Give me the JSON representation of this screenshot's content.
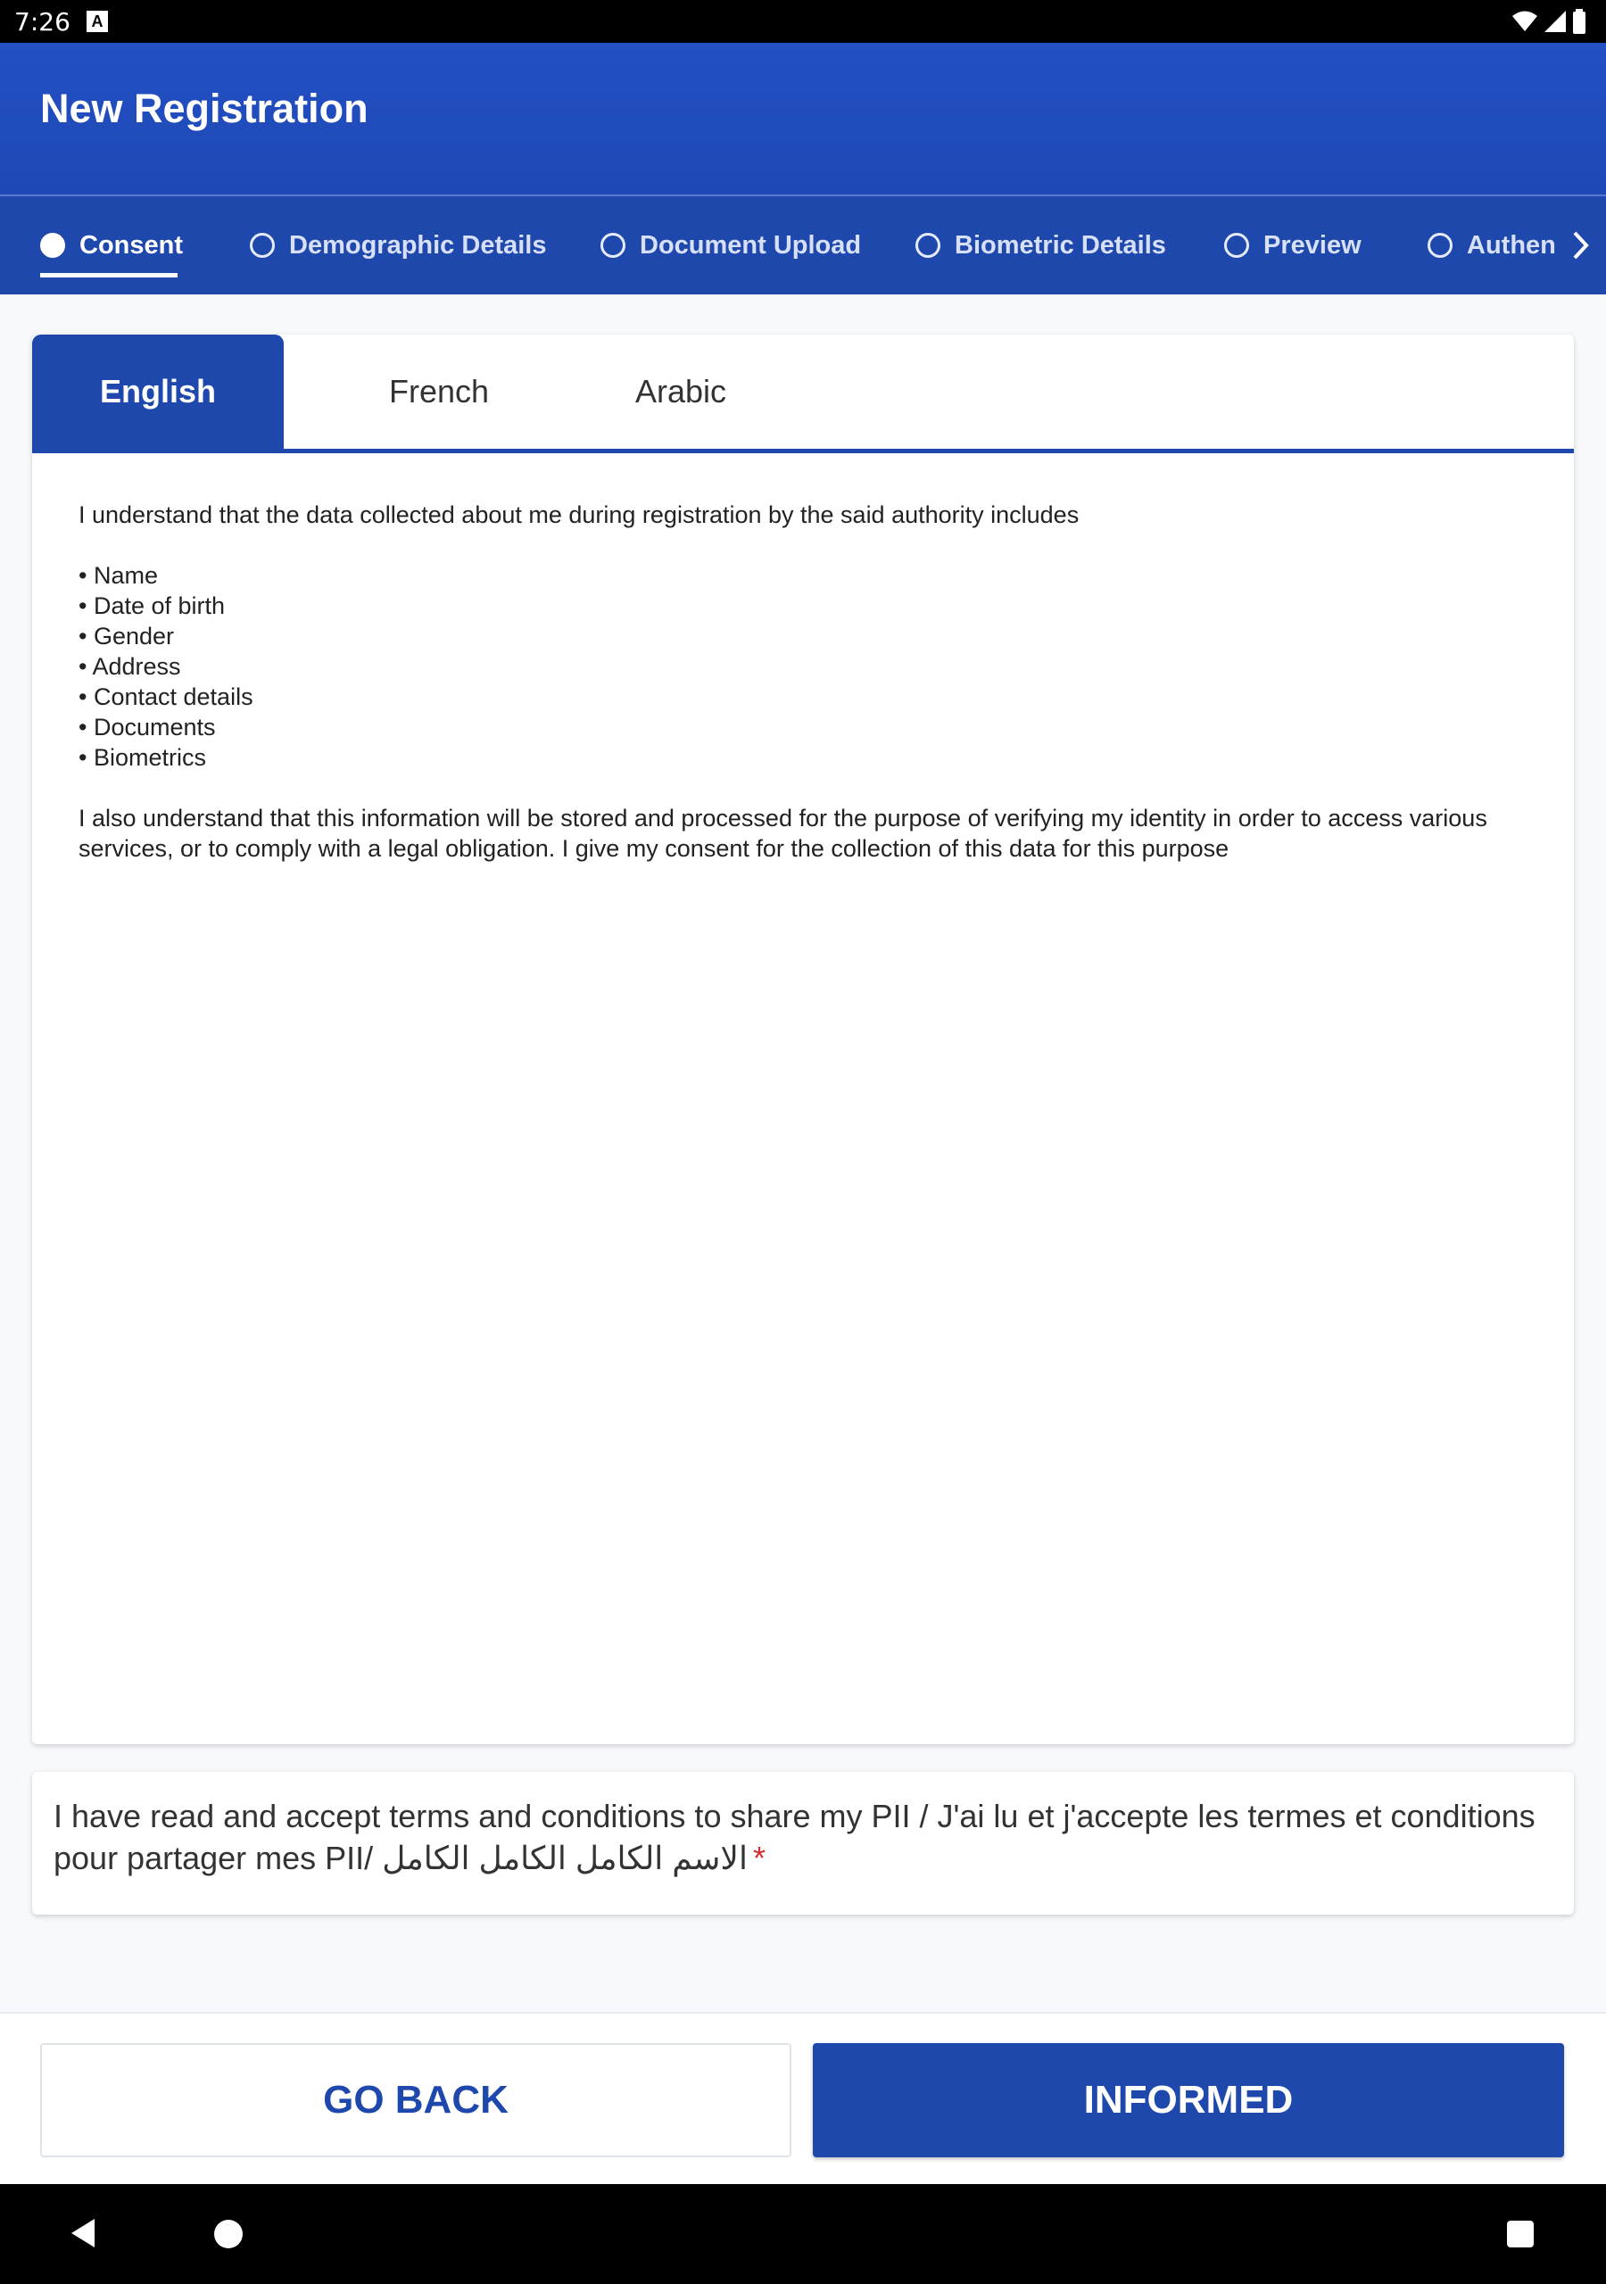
{
  "status_bar": {
    "time": "7:26",
    "notification_icon": "A"
  },
  "app_bar": {
    "title": "New Registration"
  },
  "stepper": {
    "steps": [
      {
        "label": "Consent",
        "active": true
      },
      {
        "label": "Demographic Details",
        "active": false
      },
      {
        "label": "Document Upload",
        "active": false
      },
      {
        "label": "Biometric Details",
        "active": false
      },
      {
        "label": "Preview",
        "active": false
      },
      {
        "label": "Authent",
        "active": false
      }
    ],
    "next_icon": "chevron-right-icon"
  },
  "consent": {
    "tabs": [
      {
        "label": "English",
        "active": true
      },
      {
        "label": "French",
        "active": false
      },
      {
        "label": "Arabic",
        "active": false
      }
    ],
    "intro": "I understand that the data collected about me during registration by the said authority includes",
    "items": [
      "Name",
      "Date of birth",
      "Gender",
      "Address",
      "Contact details",
      "Documents",
      "Biometrics"
    ],
    "closing": "I also understand that this information will be stored and processed for the purpose of verifying my identity in order to access various services, or to comply with a legal obligation. I give my consent for the collection of this data for this purpose"
  },
  "accept": {
    "text": "I have read and accept terms and conditions to share my PII / J'ai lu et j'accepte les termes et conditions pour partager mes PII/ الاسم الكامل الكامل الكامل",
    "required_mark": "*"
  },
  "buttons": {
    "back": "GO BACK",
    "informed": "INFORMED"
  },
  "colors": {
    "primary": "#1f48ad",
    "app_bar": "#2450c4",
    "required": "#d32f2f"
  }
}
